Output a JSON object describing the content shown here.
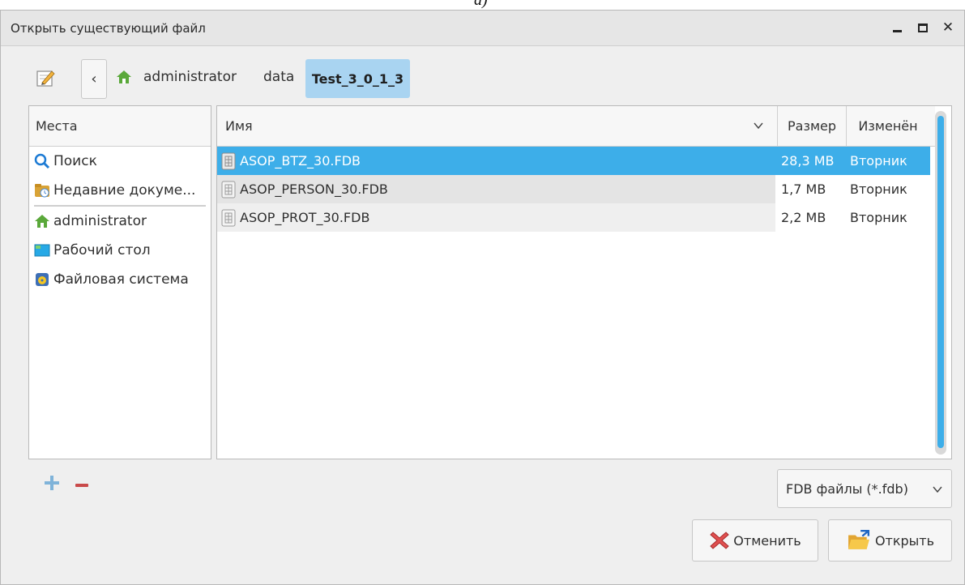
{
  "caption": "a)",
  "window": {
    "title": "Открыть существующий файл"
  },
  "breadcrumbs": [
    "administrator",
    "data",
    "Test_3_0_1_3"
  ],
  "places": {
    "header": "Места",
    "items": [
      {
        "label": "Поиск",
        "icon": "search-icon"
      },
      {
        "label": "Недавние докуме...",
        "icon": "recent-documents-icon"
      },
      {
        "label": "administrator",
        "icon": "home-icon"
      },
      {
        "label": "Рабочий стол",
        "icon": "desktop-icon"
      },
      {
        "label": "Файловая система",
        "icon": "drive-icon"
      }
    ]
  },
  "files": {
    "columns": {
      "name": "Имя",
      "size": "Размер",
      "modified": "Изменён"
    },
    "rows": [
      {
        "name": "ASOP_BTZ_30.FDB",
        "size": "28,3 MB",
        "modified": "Вторник"
      },
      {
        "name": "ASOP_PERSON_30.FDB",
        "size": "1,7 MB",
        "modified": "Вторник"
      },
      {
        "name": "ASOP_PROT_30.FDB",
        "size": "2,2 MB",
        "modified": "Вторник"
      }
    ],
    "selected_index": 0
  },
  "filter": {
    "selected": "FDB файлы (*.fdb)"
  },
  "buttons": {
    "cancel": "Отменить",
    "open": "Открыть"
  },
  "colors": {
    "accent": "#3daee9",
    "crumb_active": "#a9d4f1",
    "home": "#5aa83a"
  }
}
